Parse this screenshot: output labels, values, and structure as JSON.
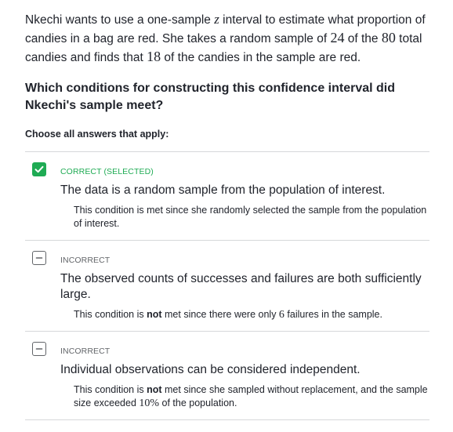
{
  "question": {
    "part1": "Nkechi wants to use a one-sample ",
    "var_z": "z",
    "part2": " interval to estimate what proportion of candies in a bag are red. She takes a random sample of ",
    "n_sample": "24",
    "part3": " of the ",
    "n_total": "80",
    "part4": " total candies and finds that ",
    "n_red": "18",
    "part5": " of the candies in the sample are red."
  },
  "prompt": "Which conditions for constructing this confidence interval did Nkechi's sample meet?",
  "instruction": "Choose all answers that apply:",
  "choices": [
    {
      "status": "CORRECT (SELECTED)",
      "text": "The data is a random sample from the population of interest.",
      "rationale": "This condition is met since she randomly selected the sample from the population of interest.",
      "checked": true
    },
    {
      "status": "INCORRECT",
      "text": "The observed counts of successes and failures are both sufficiently large.",
      "rationale_pre": "This condition is ",
      "rationale_bold": "not",
      "rationale_mid": " met since there were only ",
      "rationale_num": "6",
      "rationale_post": " failures in the sample.",
      "checked": false
    },
    {
      "status": "INCORRECT",
      "text": "Individual observations can be considered independent.",
      "rationale_pre": "This condition is ",
      "rationale_bold": "not",
      "rationale_mid": " met since she sampled without replacement, and the sample size exceeded ",
      "rationale_num": "10%",
      "rationale_post": " of the population.",
      "checked": false
    }
  ],
  "colors": {
    "correct": "#1fab54",
    "text": "#21242c",
    "muted": "#626569",
    "divider": "#d6d8da"
  }
}
